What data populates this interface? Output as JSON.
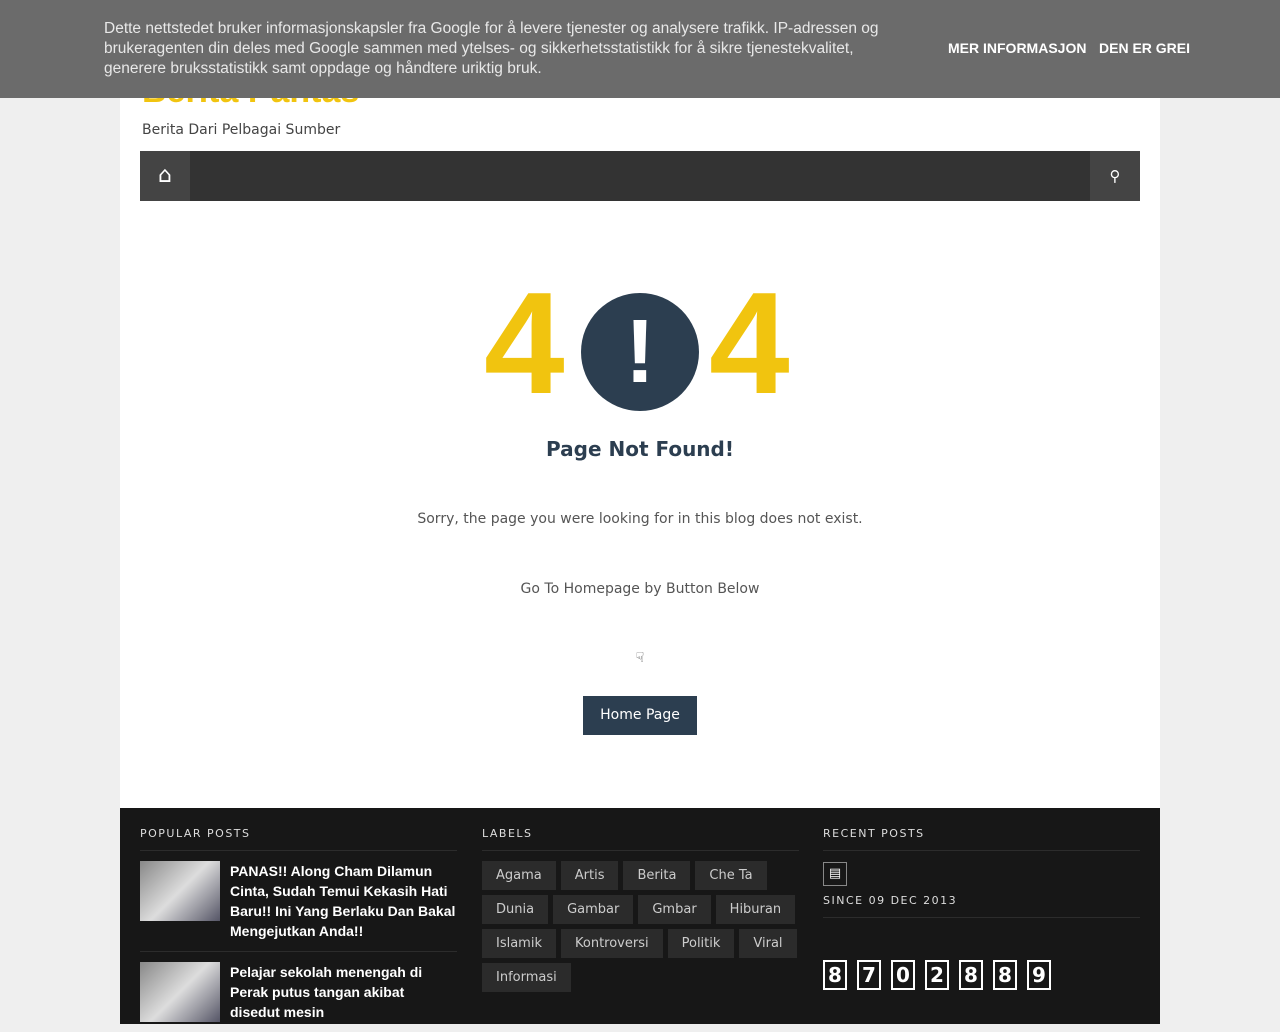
{
  "site": {
    "title": "Berita Pantas",
    "tagline": "Berita Dari Pelbagai Sumber"
  },
  "nav": {
    "home_icon": "home-icon",
    "search_icon": "search-icon"
  },
  "error": {
    "d1": "4",
    "d2": "4",
    "mark": "!",
    "title": "Page Not Found!",
    "msg": "Sorry, the page you were looking for in this blog does not exist.",
    "hint": "Go To Homepage by Button Below",
    "hand": "☟",
    "button": "Home Page"
  },
  "footer": {
    "popular": {
      "heading": "POPULAR POSTS",
      "posts": [
        "PANAS!! Along Cham Dilamun Cinta, Sudah Temui Kekasih Hati Baru!! Ini Yang Berlaku Dan Bakal Mengejutkan Anda!!",
        "Pelajar sekolah menengah di Perak putus tangan akibat disedut mesin"
      ]
    },
    "labels": {
      "heading": "LABELS",
      "items": [
        "Agama",
        "Artis",
        "Berita",
        "Che Ta",
        "Dunia",
        "Gambar",
        "Gmbar",
        "Hiburan",
        "Islamik",
        "Kontroversi",
        "Politik",
        "Viral",
        "Informasi"
      ]
    },
    "recent": {
      "heading": "RECENT POSTS",
      "since": "SINCE 09 DEC 2013",
      "counter": [
        "8",
        "7",
        "0",
        "2",
        "8",
        "8",
        "9"
      ]
    }
  },
  "cookie": {
    "text": "Dette nettstedet bruker informasjonskapsler fra Google for å levere tjenester og analysere trafikk. IP-adressen og brukeragenten din deles med Google sammen med ytelses- og sikkerhetsstatistikk for å sikre tjenestekvalitet, generere bruksstatistikk samt oppdage og håndtere uriktig bruk.",
    "more": "MER INFORMASJON",
    "ok": "DEN ER GREI"
  }
}
